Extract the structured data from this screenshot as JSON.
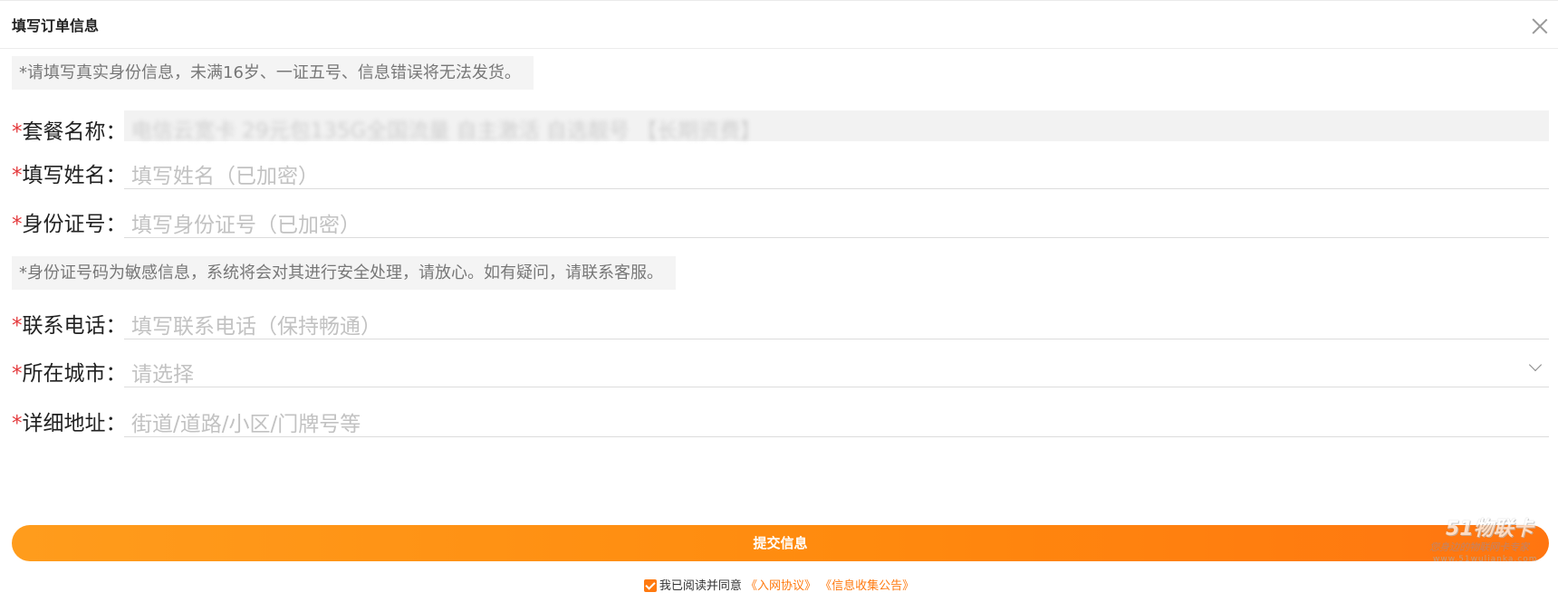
{
  "header": {
    "title": "填写订单信息"
  },
  "notices": {
    "top": "*请填写真实身份信息，未满16岁、一证五号、信息错误将无法发货。",
    "idcard": "*身份证号码为敏感信息，系统将会对其进行安全处理，请放心。如有疑问，请联系客服。"
  },
  "form": {
    "package": {
      "label": "套餐名称：",
      "value": "电信云宽卡 29元包135G全国流量 自主激活 自选靓号 【长期资费】"
    },
    "name": {
      "label": "填写姓名：",
      "placeholder": "填写姓名（已加密）"
    },
    "idcard": {
      "label": "身份证号：",
      "placeholder": "填写身份证号（已加密）"
    },
    "phone": {
      "label": "联系电话：",
      "placeholder": "填写联系电话（保持畅通）"
    },
    "city": {
      "label": "所在城市：",
      "placeholder": "请选择"
    },
    "address": {
      "label": "详细地址：",
      "placeholder": "街道/道路/小区/门牌号等"
    },
    "required_mark": "*"
  },
  "submit": {
    "label": "提交信息"
  },
  "agreement": {
    "checked": true,
    "text": "我已阅读并同意",
    "link1": "《入网协议》",
    "link2": "《信息收集公告》"
  },
  "watermark": {
    "logo": "51物联卡",
    "tagline": "您身边的物联网卡专家",
    "url": "www.51wulianka.com"
  },
  "colors": {
    "accent": "#ff7a10",
    "required": "#e4393c"
  }
}
